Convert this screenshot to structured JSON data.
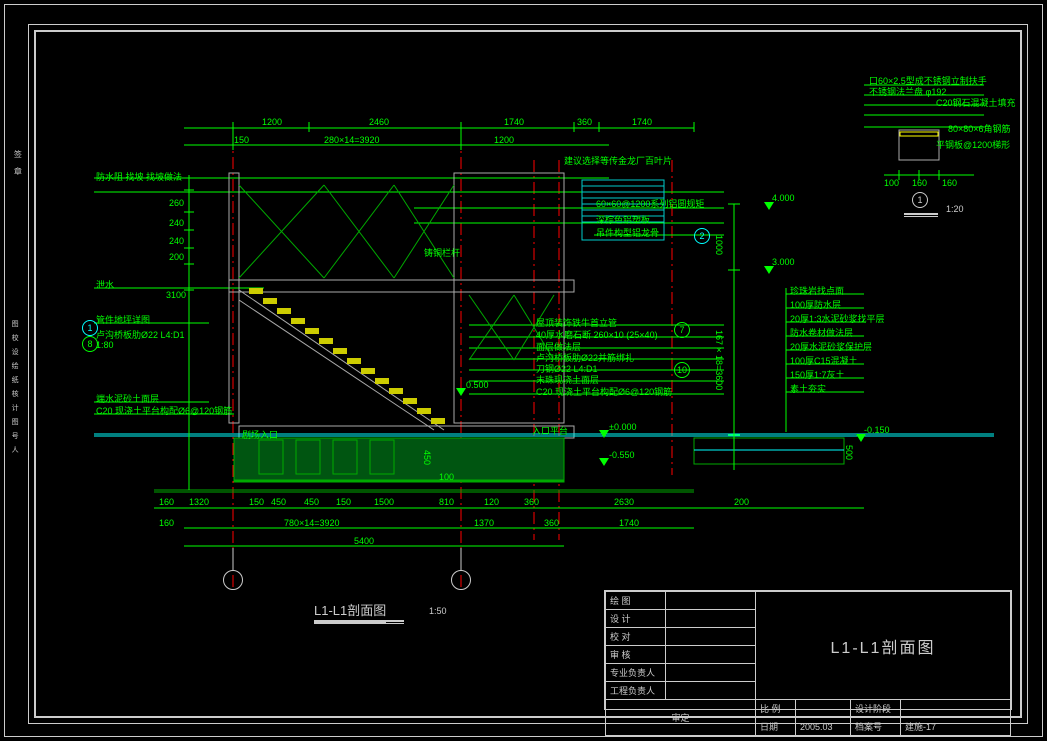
{
  "title": "L1-L1剖面图",
  "main_scale": "1:50",
  "detail_id": "1",
  "detail_scale": "1:20",
  "dimensions": {
    "top": [
      "1200",
      "2460",
      "1740",
      "360",
      "1740"
    ],
    "top2_left": "150",
    "top2_mid": "280×14=3920",
    "top2_right": "1200",
    "left_stack": [
      "260",
      "240",
      "240",
      "200",
      "3100"
    ],
    "bottom_cells": [
      "1320",
      "150",
      "450",
      "450",
      "150",
      "1500",
      "810",
      "120",
      "360",
      "2630",
      "200"
    ],
    "bottom_span": "780×14=3920",
    "bottom_span2": "1370",
    "bottom_span3": "360",
    "bottom_span4": "1740",
    "bottom_total": "5400",
    "margin_left": "160",
    "margin_bottom": "160",
    "step_h": "450",
    "step_tag": "100",
    "floor_h": "167×18=3600",
    "right_h": "1000",
    "pool_depth": "500"
  },
  "levels": {
    "roof": "4.000",
    "floor2": "3.000",
    "step": "0.500",
    "ground": "±0.000",
    "base": "-0.550",
    "pool": "-0.150"
  },
  "annotations": {
    "top_left": "防水阻 找坡 找坡做法",
    "top_right": "建议选择等传金龙厂百叶片",
    "purlin": "60×60@1200系列铝圆规矩",
    "panel": "深棕色铝塑板",
    "ceiling": "吊件构型铝龙骨",
    "wall_mid": "铸铜栏杆",
    "left1": "泄水",
    "left2": "管件地坪详图",
    "left3": "卢沟桥板肋Ø22 L4:D1",
    "left4": "1:80",
    "left5": "端水泥砂土面层",
    "left6": "C20 现浇土平台构配Ø6@120钢筋",
    "entry": "剧场入口",
    "right_list": [
      "屋顶装饰铁牛首立管",
      "40厚水磨石断 260×10 (25×40)",
      "面层做法层",
      "卢沟桥板肋Ø22并筋绑扎",
      "刀钢Ø22 L4:D1",
      "末珠现浇土面层",
      "C20 现浇土平台构配Ø6@120钢筋"
    ],
    "platform": "入口平台",
    "section_list": [
      "珍珠岩找点面",
      "100厚防水层",
      "20厚1:3水泥砂浆找平层",
      "防水卷材做法层",
      "20厚水泥砂浆保护层",
      "100厚C15混凝土",
      "150厚1:7灰土",
      "素土夯实"
    ],
    "detail_list": [
      "口60×2.5型成不锈钢立制扶手",
      "不锈钢法兰盘 φ192",
      "C20钢石混凝土填充",
      "80×80×6角钢筋",
      "平钢板@1200梯形"
    ],
    "detail_dims": [
      "100",
      "160",
      "160"
    ]
  },
  "titleblock": {
    "rows": [
      [
        "绘 图",
        ""
      ],
      [
        "设 计",
        ""
      ],
      [
        "校 对",
        ""
      ],
      [
        "审 核",
        ""
      ],
      [
        "专业负责人",
        ""
      ],
      [
        "工程负责人",
        ""
      ]
    ],
    "sheet_title": "L1-L1剖面图",
    "ratio_label": "比 例",
    "stage_label": "设计阶段",
    "approve": "审定",
    "date_label": "日期",
    "date": "2005.03",
    "archive_label": "档案号",
    "sheet_no": "建施-17"
  },
  "side_labels": {
    "top": "签 章",
    "bottom": "图 校 设 绘\n纸 核 计 图\n号        人"
  }
}
